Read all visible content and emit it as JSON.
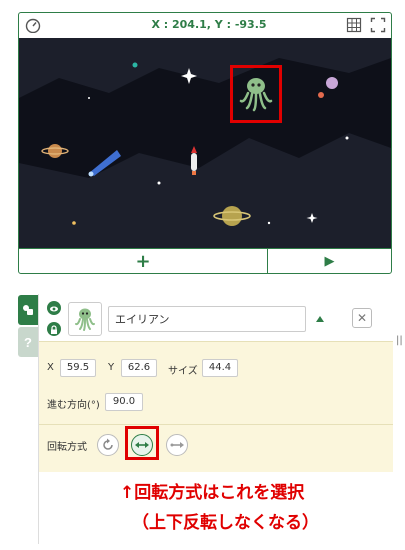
{
  "stage": {
    "coordinates": "X : 204.1, Y : -93.5",
    "add_label": "+",
    "play_label": "▶"
  },
  "sprite": {
    "name": "エイリアン",
    "delete_label": "✕",
    "x_label": "X",
    "x_value": "59.5",
    "y_label": "Y",
    "y_value": "62.6",
    "size_label": "サイズ",
    "size_value": "44.4",
    "direction_label": "進む方向(°)",
    "direction_value": "90.0",
    "rotation_label": "回転方式",
    "rotation_selected": "left-right"
  },
  "tabs": {
    "help_label": "?"
  },
  "rail_label": "||",
  "annotation": {
    "line1": "↑回転方式はこれを選択",
    "line2": "（上下反転しなくなる）"
  },
  "colors": {
    "accent": "#2e7d47",
    "highlight": "#e00000",
    "stage_bg": "#1c1f2b",
    "props_bg": "#fbf6dc"
  }
}
